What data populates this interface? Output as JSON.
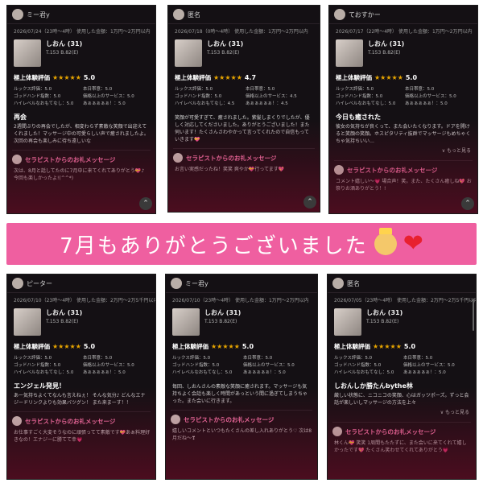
{
  "banner": {
    "text": "7月もありがとうございました",
    "heart": "❤"
  },
  "cards": [
    {
      "user": "ミー君y",
      "meta": "2026/07/24（23時〜4時） 使用した金額：1万円〜2万円以内",
      "name": "しおん (31)",
      "stats": "T.153 B.82(E)",
      "rating_label": "極上体験評価",
      "stars": "★★★★★",
      "score": "5.0",
      "subs": [
        "ルックス評価：5.0",
        "本日帯意：5.0",
        "ゴッドハンド指数：5.0",
        "価格以上のサービス：5.0",
        "ハイレベルなおもてなし：5.0",
        "あぁぁぁぁぁ！：5.0"
      ],
      "title": "再会",
      "text": "2週間ぶりの再会でしたが、相変わらず素敵な笑顔で出迎えてくれました！マッサージ中の可愛らしい声で癒されましたよ。次回の再会も楽しみに待ち遠しいな",
      "more": "",
      "reply_head": "セラピストからのお礼メッセージ",
      "reply": "次は、8月と話してたのに7月中に来てくれてありがとう💝♪ 今回も楽しかったよ!(^^*)"
    },
    {
      "user": "匿名",
      "meta": "2026/07/18（0時〜4時） 使用した金額：1万円〜2万円以内",
      "name": "しおん (31)",
      "stats": "T.153 B.82(E)",
      "rating_label": "極上体験評価",
      "stars": "★★★★★",
      "score": "4.7",
      "subs": [
        "ルックス評価：5.0",
        "本日帯意：5.0",
        "ゴッドハンド指数：5.0",
        "価格以上のサービス：4.5",
        "ハイレベルなおもてなし：4.5",
        "あぁぁぁぁぁ！：4.5"
      ],
      "title": "",
      "text": "笑顔が可愛すぎて、癒されました。紫髪しまくりでしたが、優しく対応してくださいました。ありがとうございました！また伺います！たくさんさわやかって言ってくれたので自信もっていきます💝",
      "more": "",
      "reply_head": "セラピストからのお礼メッセージ",
      "reply": "お言い実感だったね！笑笑 爽やか💝行ってます💖"
    },
    {
      "user": "ておすかー",
      "meta": "2026/07/17（22時〜4時） 使用した金額：1万円〜2万円以内",
      "name": "しおん (31)",
      "stats": "T.153 B.82(E)",
      "rating_label": "極上体験評価",
      "stars": "★★★★★",
      "score": "5.0",
      "subs": [
        "ルックス評価：5.0",
        "本日帯意：5.0",
        "ゴッドハンド指数：5.0",
        "価格以上のサービス：5.0",
        "ハイレベルなおもてなし：5.0",
        "あぁぁぁぁぁ！：5.0"
      ],
      "title": "今日も癒された",
      "text": "彼女の気持ちが良くって、また会いたくなります。ドアを開けると笑顔の笑顔。ホスピタリティ抜群でマッサージもめちゃくちゃ気持ちいい…",
      "more": "∨ もっと見る",
      "reply_head": "セラピストからのお礼メッセージ",
      "reply": "コメント嬉しい〜💗 場合声！笑。また、たくさん癒しね💖 お祭りお酒ありがとう！!"
    },
    {
      "user": "ピーター",
      "meta": "2026/07/10（23時〜4時） 使用した金額：2万円〜2万5千円以内",
      "name": "しおん (31)",
      "stats": "T.153 B.82(E)",
      "rating_label": "極上体験評価",
      "stars": "★★★★★",
      "score": "5.0",
      "subs": [
        "ルックス評価：5.0",
        "本日帯意：5.0",
        "ゴッドハンド指数：5.0",
        "価格以上のサービス：5.0",
        "ハイレベルなおもてなし：5.0",
        "あぁぁぁぁぁ！：5.0"
      ],
      "title": "エンジェル発見！",
      "text": "あー気持ちよくてなんも言えねぇ！ そんな気分♪ どんなエナジードリンクよりも効果バツグン！ また来まーす！！",
      "more": "",
      "reply_head": "セラピストからのお礼メッセージ",
      "reply": "お仕事すごく大変そうなのに頑張ってて素敵です💝あぁ料理好きなの！エナジーに勝てて幸💗"
    },
    {
      "user": "ミー君y",
      "meta": "2026/07/10（23時〜4時） 使用した金額：1万円〜2万円以内",
      "name": "しおん (31)",
      "stats": "T.153 B.82(E)",
      "rating_label": "極上体験評価",
      "stars": "★★★★★",
      "score": "5.0",
      "subs": [
        "ルックス評価：5.0",
        "本日帯意：5.0",
        "ゴッドハンド指数：5.0",
        "価格以上のサービス：5.0",
        "ハイレベルなおもてなし：5.0",
        "あぁぁぁぁぁ！：5.0"
      ],
      "title": "",
      "text": "毎回、しおんさんの素敵な笑顔に癒されます。マッサージも気持ちよく会話も楽しく時間があっという間に過ぎてしまうちゃった。また会いに行きます。",
      "more": "",
      "reply_head": "セラピストからのお礼メッセージ",
      "reply": "嬉しいコメントといつもたくさんの差し入れありがとう♡ 次は8月だね〜❣"
    },
    {
      "user": "匿名",
      "meta": "2026/07/05（23時〜4時） 使用した金額：2万円〜2万5千円以内",
      "name": "しおん (31)",
      "stats": "T.153 B.82(E)",
      "rating_label": "極上体験評価",
      "stars": "★★★★★",
      "score": "5.0",
      "subs": [
        "ルックス評価：5.0",
        "本日帯意：5.0",
        "ゴッドハンド指数：5.0",
        "価格以上のサービス：5.0",
        "ハイレベルなおもてなし：5.0",
        "あぁぁぁぁぁ！：5.0"
      ],
      "title": "しおんしか勝たんbythe林",
      "text": "厳しい状態に、ニコニコの笑顔、心はガッツポーズ。ずっと会話が楽しいしマッサージの方法を上々",
      "more": "∨ もっと見る",
      "reply_head": "セラピストからのお礼メッセージ",
      "reply": "林くん💝 笑笑 1周間もたたずに、また会いに来てくれて嬉しかったです💖 たくさん笑わせてくれてありがとう💗"
    }
  ]
}
